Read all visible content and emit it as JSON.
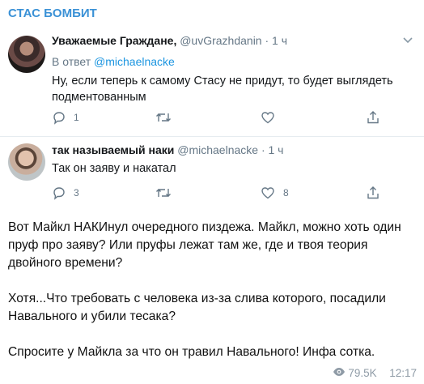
{
  "channel": {
    "name": "СТАС БОМБИТ"
  },
  "tweets": [
    {
      "display_name": "Уважаемые Граждане,",
      "handle": "@uvGrazhdanin",
      "time": "· 1 ч",
      "reply_prefix": "В ответ",
      "reply_handle": "@michaelnacke",
      "text_lines": [
        "Ну, если теперь к самому Стасу не придут, то будет выглядеть",
        "подментованным"
      ],
      "replies": "1",
      "retweets": "",
      "likes": ""
    },
    {
      "display_name": "так называемый наки",
      "handle": "@michaelnacke",
      "time": "· 1 ч",
      "text_lines": [
        "Так он заяву и накатал"
      ],
      "replies": "3",
      "retweets": "",
      "likes": "8"
    }
  ],
  "post": {
    "paragraphs": [
      "Вот Майкл НАКИнул очередного пиздежа. Майкл, можно хоть один пруф про заяву? Или пруфы лежат там же, где и твоя теория двойного времени?",
      "Хотя...Что требовать с человека из-за слива которого, посадили Навального и убили тесака?",
      "Спросите у Майкла за что он травил Навального! Инфа сотка."
    ]
  },
  "meta": {
    "views": "79.5K",
    "time": "12:17"
  },
  "icons": {
    "reply": "reply-icon",
    "retweet": "retweet-icon",
    "like": "heart-icon",
    "share": "share-icon",
    "views": "eye-icon"
  },
  "colors": {
    "channel": "#3a91d6",
    "link": "#1b95e0",
    "muted": "#657786"
  }
}
